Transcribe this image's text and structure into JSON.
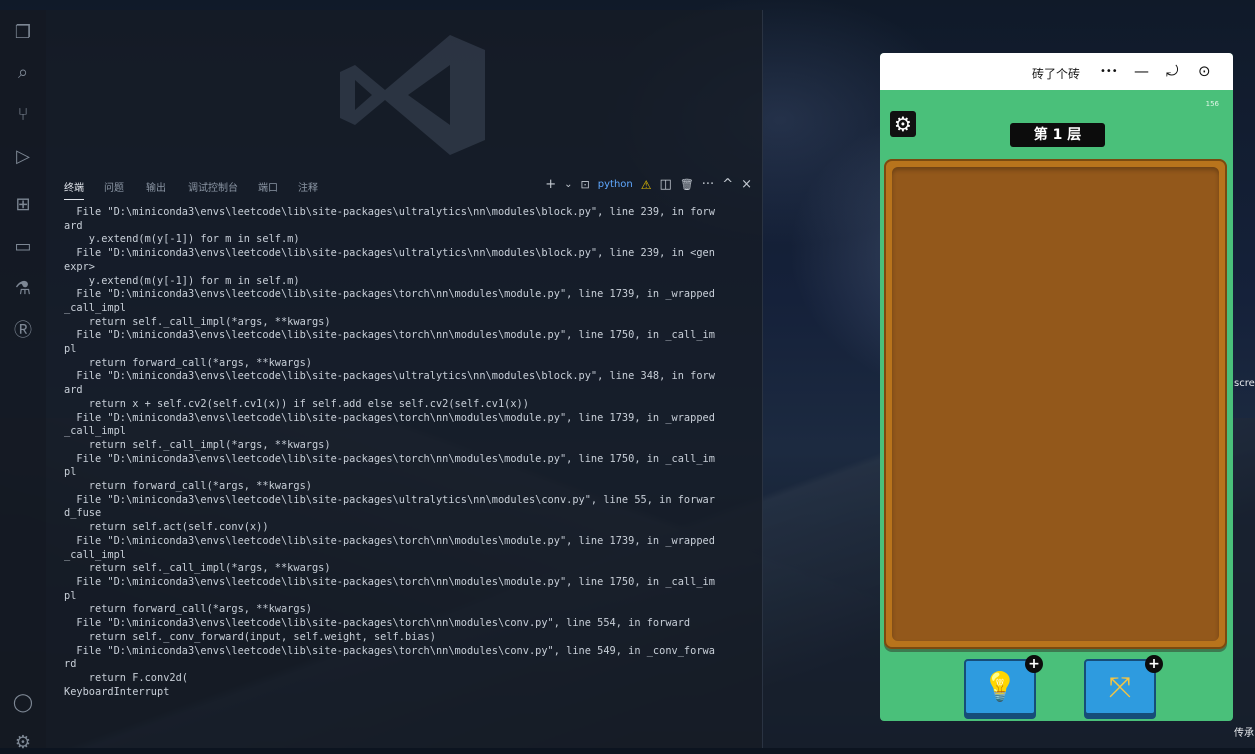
{
  "vscode": {
    "panel_tabs": [
      "终端",
      "问题",
      "输出",
      "调试控制台",
      "端口",
      "注释"
    ],
    "active_tab_index": 0,
    "actions": {
      "add": "+",
      "add_chevron": "⌄",
      "shell_name": "python",
      "warning": "⚠",
      "split": "◫",
      "trash": "🗑",
      "more": "···",
      "maximize": "^",
      "close": "×"
    },
    "terminal_lines": [
      "  File \"D:\\miniconda3\\envs\\leetcode\\lib\\site-packages\\ultralytics\\nn\\modules\\block.py\", line 239, in forw",
      "ard",
      "    y.extend(m(y[-1]) for m in self.m)",
      "  File \"D:\\miniconda3\\envs\\leetcode\\lib\\site-packages\\ultralytics\\nn\\modules\\block.py\", line 239, in <gen",
      "expr>",
      "    y.extend(m(y[-1]) for m in self.m)",
      "  File \"D:\\miniconda3\\envs\\leetcode\\lib\\site-packages\\torch\\nn\\modules\\module.py\", line 1739, in _wrapped",
      "_call_impl",
      "    return self._call_impl(*args, **kwargs)",
      "  File \"D:\\miniconda3\\envs\\leetcode\\lib\\site-packages\\torch\\nn\\modules\\module.py\", line 1750, in _call_im",
      "pl",
      "    return forward_call(*args, **kwargs)",
      "  File \"D:\\miniconda3\\envs\\leetcode\\lib\\site-packages\\ultralytics\\nn\\modules\\block.py\", line 348, in forw",
      "ard",
      "    return x + self.cv2(self.cv1(x)) if self.add else self.cv2(self.cv1(x))",
      "  File \"D:\\miniconda3\\envs\\leetcode\\lib\\site-packages\\torch\\nn\\modules\\module.py\", line 1739, in _wrapped",
      "_call_impl",
      "    return self._call_impl(*args, **kwargs)",
      "  File \"D:\\miniconda3\\envs\\leetcode\\lib\\site-packages\\torch\\nn\\modules\\module.py\", line 1750, in _call_im",
      "pl",
      "    return forward_call(*args, **kwargs)",
      "  File \"D:\\miniconda3\\envs\\leetcode\\lib\\site-packages\\ultralytics\\nn\\modules\\conv.py\", line 55, in forwar",
      "d_fuse",
      "    return self.act(self.conv(x))",
      "  File \"D:\\miniconda3\\envs\\leetcode\\lib\\site-packages\\torch\\nn\\modules\\module.py\", line 1739, in _wrapped",
      "_call_impl",
      "    return self._call_impl(*args, **kwargs)",
      "  File \"D:\\miniconda3\\envs\\leetcode\\lib\\site-packages\\torch\\nn\\modules\\module.py\", line 1750, in _call_im",
      "pl",
      "    return forward_call(*args, **kwargs)",
      "  File \"D:\\miniconda3\\envs\\leetcode\\lib\\site-packages\\torch\\nn\\modules\\conv.py\", line 554, in forward",
      "    return self._conv_forward(input, self.weight, self.bias)",
      "  File \"D:\\miniconda3\\envs\\leetcode\\lib\\site-packages\\torch\\nn\\modules\\conv.py\", line 549, in _conv_forwa",
      "rd",
      "    return F.conv2d(",
      "KeyboardInterrupt"
    ]
  },
  "miniprogram": {
    "title": "砖了个砖",
    "controls": {
      "more": "•••",
      "minimize": "—",
      "restore": "⤾",
      "close": "⊙"
    },
    "counter": "156",
    "level_label": "第 1 层",
    "gear": "⚙",
    "tools": [
      {
        "glyph": "💡",
        "plus": "+"
      },
      {
        "glyph": "⤧",
        "plus": "+"
      }
    ]
  },
  "desktop": {
    "edge_text_1": "scre",
    "edge_text_2": "传承"
  },
  "colors": {
    "game_green": "#4ac07a",
    "board_wood": "#93581b",
    "tool_blue": "#2e9bdf"
  }
}
